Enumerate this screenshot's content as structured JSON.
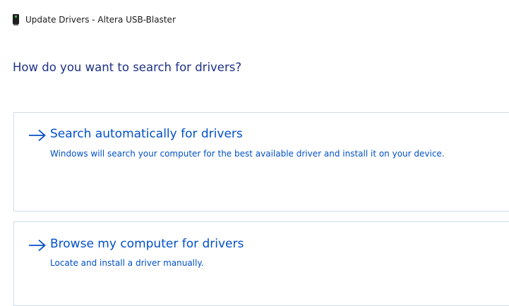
{
  "window": {
    "title": "Update Drivers - Altera USB-Blaster",
    "icon": "usb-device-icon"
  },
  "question": "How do you want to search for drivers?",
  "options": [
    {
      "icon": "arrow-right-icon",
      "title": "Search automatically for drivers",
      "description": "Windows will search your computer for the best available driver and install it on your device."
    },
    {
      "icon": "arrow-right-icon",
      "title": "Browse my computer for drivers",
      "description": "Locate and install a driver manually."
    }
  ],
  "colors": {
    "heading": "#1e3287",
    "link": "#0050c8",
    "border": "#cfdde9"
  }
}
